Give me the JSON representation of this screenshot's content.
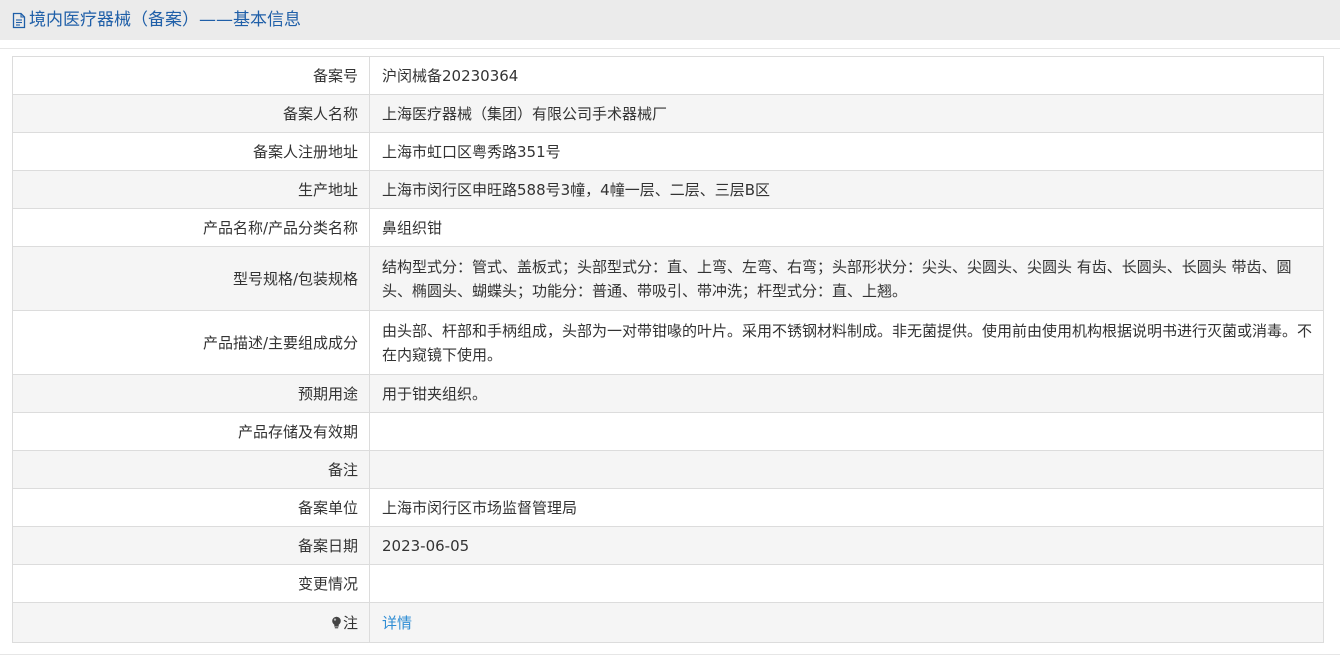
{
  "header": {
    "title": "境内医疗器械（备案）——基本信息",
    "icon": "document-icon",
    "title_color": "#1f5fa8"
  },
  "rows": [
    {
      "label": "备案号",
      "value": "沪闵械备20230364"
    },
    {
      "label": "备案人名称",
      "value": "上海医疗器械（集团）有限公司手术器械厂"
    },
    {
      "label": "备案人注册地址",
      "value": "上海市虹口区粤秀路351号"
    },
    {
      "label": "生产地址",
      "value": "上海市闵行区申旺路588号3幢，4幢一层、二层、三层B区"
    },
    {
      "label": "产品名称/产品分类名称",
      "value": "鼻组织钳"
    },
    {
      "label": "型号规格/包装规格",
      "value": "结构型式分：管式、盖板式；头部型式分：直、上弯、左弯、右弯；头部形状分：尖头、尖圆头、尖圆头 有齿、长圆头、长圆头 带齿、圆头、椭圆头、蝴蝶头；功能分：普通、带吸引、带冲洗；杆型式分：直、上翘。"
    },
    {
      "label": "产品描述/主要组成成分",
      "value": "由头部、杆部和手柄组成，头部为一对带钳喙的叶片。采用不锈钢材料制成。非无菌提供。使用前由使用机构根据说明书进行灭菌或消毒。不在内窥镜下使用。"
    },
    {
      "label": "预期用途",
      "value": "用于钳夹组织。"
    },
    {
      "label": "产品存储及有效期",
      "value": ""
    },
    {
      "label": "备注",
      "value": ""
    },
    {
      "label": "备案单位",
      "value": "上海市闵行区市场监督管理局"
    },
    {
      "label": "备案日期",
      "value": "2023-06-05"
    },
    {
      "label": "变更情况",
      "value": ""
    }
  ],
  "note_row": {
    "label": "注",
    "icon": "lightbulb-icon",
    "link_text": "详情",
    "link_color": "#2f8dd4"
  }
}
